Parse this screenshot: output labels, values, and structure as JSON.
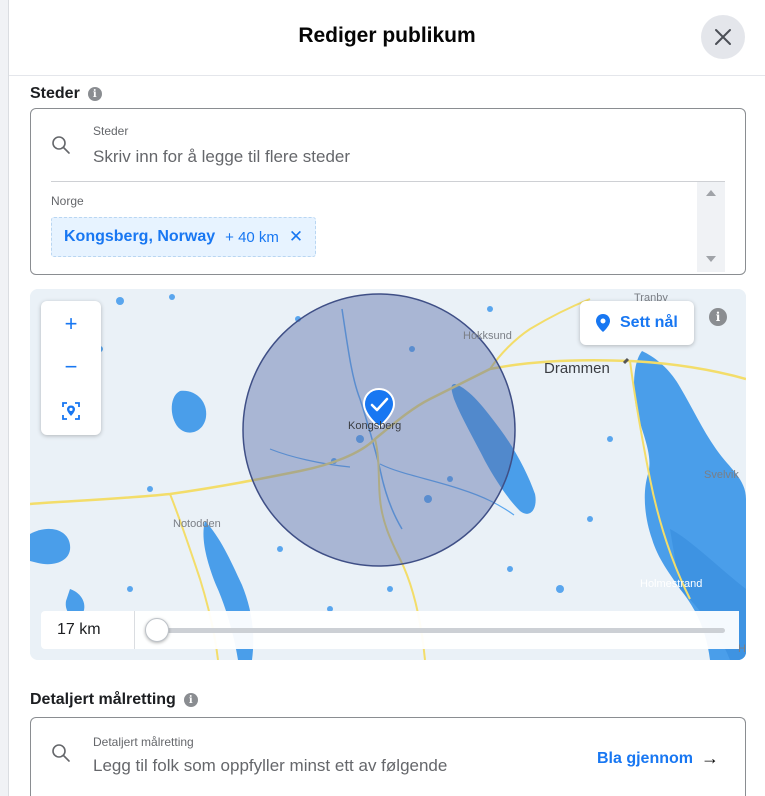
{
  "header": {
    "title": "Rediger publikum",
    "close_icon": "close-icon"
  },
  "locations": {
    "section_title": "Steder",
    "info_icon": "i",
    "search_label": "Steder",
    "search_placeholder": "Skriv inn for å legge til flere steder",
    "group_label": "Norge",
    "selected": [
      {
        "name": "Kongsberg, Norway",
        "radius": "+ 40 km",
        "remove": "✕"
      }
    ]
  },
  "map": {
    "zoom_in": "+",
    "zoom_out": "−",
    "set_pin_label": "Sett nål",
    "info_icon": "i",
    "radius_value": "17 km",
    "radius_slider_fraction": 0.0,
    "place_labels": {
      "trahby": "Tranby",
      "hokksund": "Hokksund",
      "drammen": "Drammen",
      "kongsberg": "Kongsberg",
      "svelvik": "Svelvik",
      "notodden": "Notodden",
      "holmestrand": "Holmestrand",
      "h_edge": "H"
    },
    "colors": {
      "land": "#e8f0f7",
      "water": "#4a9eea",
      "road": "#f5e27a",
      "circle_fill": "#5b6ea8",
      "pin": "#1877f2"
    }
  },
  "targeting": {
    "section_title": "Detaljert målretting",
    "info_icon": "i",
    "search_label": "Detaljert målretting",
    "search_placeholder": "Legg til folk som oppfyller minst ett av følgende",
    "browse_label": "Bla gjennom",
    "browse_arrow": "→"
  }
}
